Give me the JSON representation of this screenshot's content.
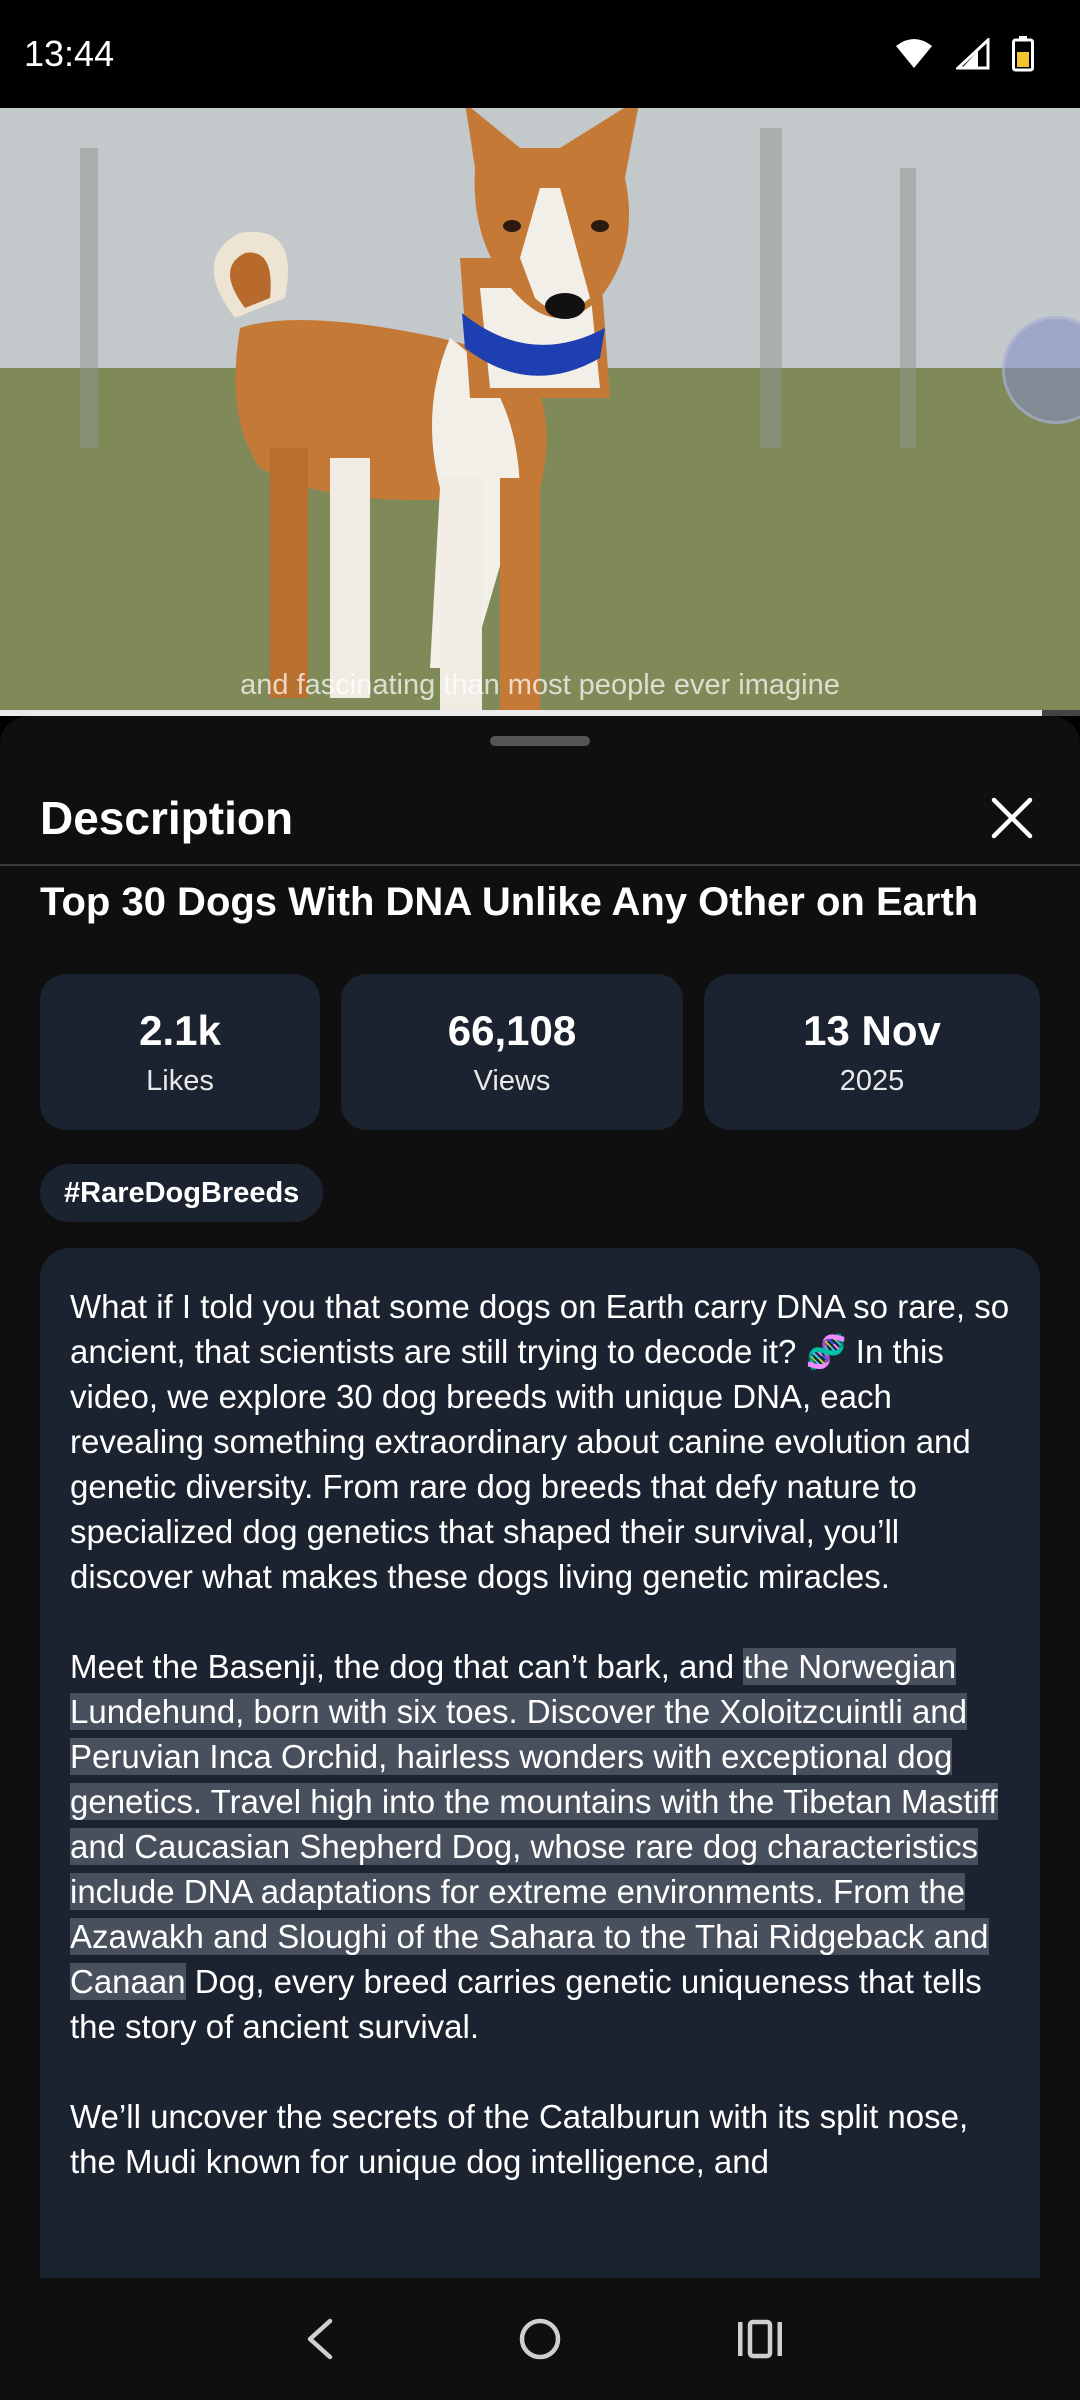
{
  "status": {
    "time": "13:44"
  },
  "video": {
    "caption": "and fascinating than most people ever imagine",
    "progress": 0.965
  },
  "sheet": {
    "title": "Description",
    "video_title": "Top 30 Dogs With DNA Unlike Any Other on Earth",
    "stats": {
      "likes_value": "2.1k",
      "likes_label": "Likes",
      "views_value": "66,108",
      "views_label": "Views",
      "date_value": "13 Nov",
      "date_year": "2025"
    },
    "hashtag": "#RareDogBreeds",
    "description": {
      "p1": "What if I told you that some dogs on Earth carry DNA so rare, so ancient, that scientists are still trying to decode it? 🧬 In this video, we explore 30 dog breeds with unique DNA, each revealing something extraordinary about canine evolution and genetic diversity. From rare dog breeds that defy nature to specialized dog genetics that shaped their survival, you’ll discover what makes these dogs living genetic miracles.",
      "p2_before": "Meet the Basenji, the dog that can’t bark, and ",
      "p2_highlight": "the Norwegian Lundehund, born with six toes. Discover the Xoloitzcuintli and Peruvian Inca Orchid, hairless wonders with exceptional dog genetics. Travel high into the mountains with the Tibetan Mastiff and Caucasian Shepherd Dog, whose rare dog characteristics include DNA adaptations for extreme environments. From the Azawakh and Sloughi of the Sahara to the Thai Ridgeback and Canaan",
      "p2_after": " Dog, every breed carries genetic uniqueness that tells the story of ancient survival.",
      "p3": "We’ll uncover the secrets of the Catalburun with its split nose, the Mudi known for unique dog intelligence, and"
    }
  }
}
